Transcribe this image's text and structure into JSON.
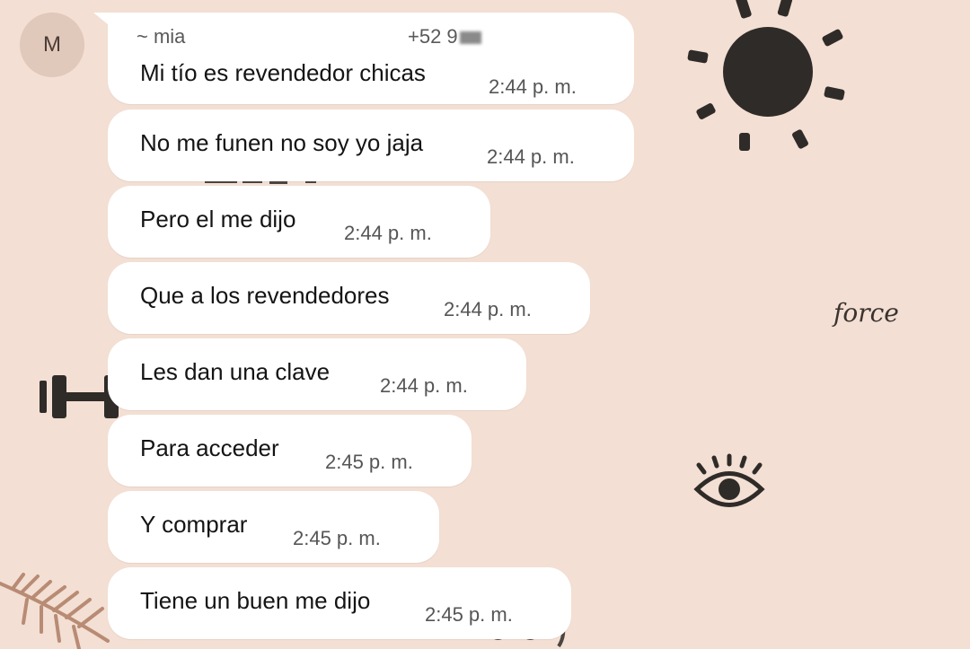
{
  "contact": {
    "avatar_letter": "M",
    "sender_name": "~ mia",
    "sender_phone_visible": "+52 9"
  },
  "messages": [
    {
      "text": "Mi tío es revendedor chicas",
      "time": "2:44 p. m."
    },
    {
      "text": "No me funen no soy yo jaja",
      "time": "2:44 p. m."
    },
    {
      "text": "Pero el me dijo",
      "time": "2:44 p. m."
    },
    {
      "text": "Que a los revendedores",
      "time": "2:44 p. m."
    },
    {
      "text": "Les dan una clave",
      "time": "2:44 p. m."
    },
    {
      "text": "Para acceder",
      "time": "2:45 p. m."
    },
    {
      "text": "Y comprar",
      "time": "2:45 p. m."
    },
    {
      "text": "Tiene un buen me dijo",
      "time": "2:45 p. m."
    }
  ],
  "wallpaper": {
    "background_color": "#f3dfd3",
    "ink_color": "#2f2b28",
    "accent_color": "#b88b74",
    "script_word": "force",
    "icons": [
      "sun-icon",
      "eye-icon",
      "dumbbell-icon",
      "fern-leaf-icon",
      "script-word-decoration"
    ]
  }
}
